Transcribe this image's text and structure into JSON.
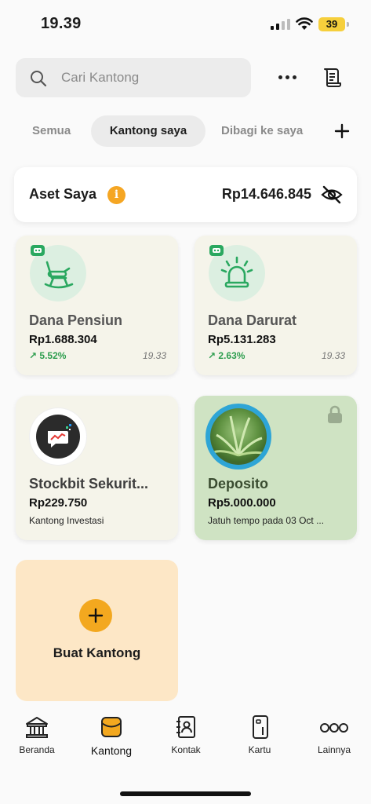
{
  "status": {
    "time": "19.39",
    "battery": "39"
  },
  "search": {
    "placeholder": "Cari Kantong"
  },
  "tabs": [
    {
      "label": "Semua",
      "active": false
    },
    {
      "label": "Kantong saya",
      "active": true
    },
    {
      "label": "Dibagi ke saya",
      "active": false
    }
  ],
  "assets": {
    "title": "Aset Saya",
    "value": "Rp14.646.845"
  },
  "pockets": {
    "pensiun": {
      "name": "Dana Pensiun",
      "balance": "Rp1.688.304",
      "growth": "5.52%",
      "time": "19.33",
      "icon": "rocking-chair-icon"
    },
    "darurat": {
      "name": "Dana Darurat",
      "balance": "Rp5.131.283",
      "growth": "2.63%",
      "time": "19.33",
      "icon": "siren-icon"
    },
    "stockbit": {
      "name": "Stockbit Sekurit...",
      "balance": "Rp229.750",
      "subtitle": "Kantong Investasi",
      "icon": "stockbit-logo"
    },
    "deposito": {
      "name": "Deposito",
      "balance": "Rp5.000.000",
      "subtitle": "Jatuh tempo pada 03 Oct ...",
      "icon": "plant-photo",
      "locked": true
    }
  },
  "create": {
    "label": "Buat Kantong"
  },
  "nav": [
    {
      "label": "Beranda",
      "icon": "bank-icon"
    },
    {
      "label": "Kantong",
      "icon": "pocket-icon",
      "active": true
    },
    {
      "label": "Kontak",
      "icon": "contact-book-icon"
    },
    {
      "label": "Kartu",
      "icon": "card-icon"
    },
    {
      "label": "Lainnya",
      "icon": "more-circles-icon"
    }
  ],
  "colors": {
    "accent": "#f3a81f",
    "green": "#2e9e4f",
    "deposito_bg": "#cfe3c3",
    "create_bg": "#fde7c6"
  }
}
